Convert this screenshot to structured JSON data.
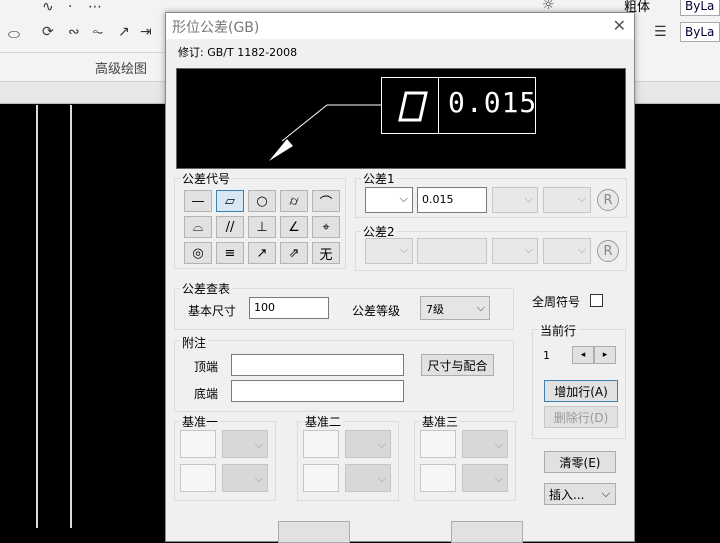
{
  "app": {
    "ribbon_group_label": "高级绘图",
    "bylayer_top": "ByLa",
    "bylayer_bottom": "ByLa",
    "bold_label": "粗体"
  },
  "dialog": {
    "title": "形位公差(GB)",
    "revision": "修订: GB/T 1182-2008",
    "preview_value": "0.015",
    "symbols_group": "公差代号",
    "symbols": [
      "—",
      "▱",
      "○",
      "⌭",
      "⌒",
      "⌓",
      "//",
      "⊥",
      "∠",
      "⌖",
      "◎",
      "≡",
      "↗",
      "⇗",
      "无"
    ],
    "tol1": {
      "label": "公差1",
      "value": "0.015",
      "circle_label": "R"
    },
    "tol2": {
      "label": "公差2",
      "circle_label": "R"
    },
    "lookup": {
      "group": "公差查表",
      "basic_size_label": "基本尺寸",
      "basic_size_value": "100",
      "grade_label": "公差等级",
      "grade_value": "7级"
    },
    "allaround_label": "全周符号",
    "current_row": {
      "group": "当前行",
      "value": "1",
      "add": "增加行(A)",
      "delete": "删除行(D)"
    },
    "notes": {
      "group": "附注",
      "top_label": "顶端",
      "bottom_label": "底端",
      "fit_button": "尺寸与配合"
    },
    "datum1": "基准一",
    "datum2": "基准二",
    "datum3": "基准三",
    "clear_button": "清零(E)",
    "insert_button": "插入..."
  }
}
